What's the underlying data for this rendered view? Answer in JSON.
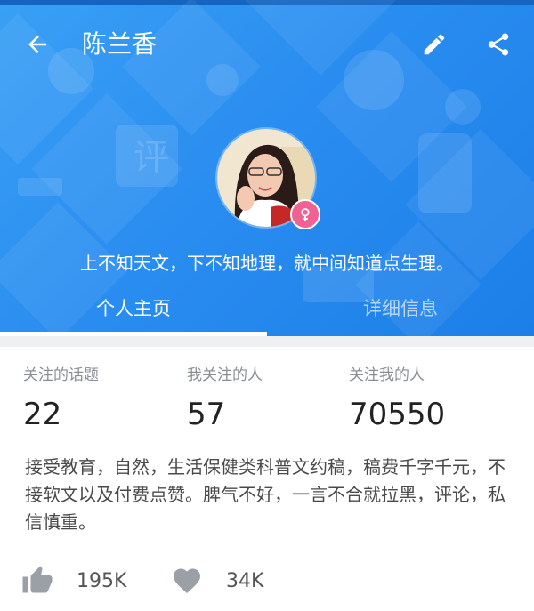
{
  "header": {
    "title": "陈兰香",
    "motto": "上不知天文，下不知地理，就中间知道点生理。",
    "tabs": [
      {
        "label": "个人主页",
        "active": true
      },
      {
        "label": "详细信息",
        "active": false
      }
    ],
    "icons": {
      "back": "arrow-left-icon",
      "edit": "pencil-icon",
      "share": "share-icon",
      "gender": "female-icon"
    },
    "colors": {
      "primary": "#2a8df0",
      "gender_badge": "#f06292"
    }
  },
  "stats": [
    {
      "label": "关注的话题",
      "value": "22"
    },
    {
      "label": "我关注的人",
      "value": "57"
    },
    {
      "label": "关注我的人",
      "value": "70550"
    }
  ],
  "bio": "接受教育，自然，生活保健类科普文约稿，稿费千字千元，不接软文以及付费点赞。脾气不好，一言不合就拉黑，评论，私信慎重。",
  "actions": {
    "likes": "195K",
    "favorites": "34K"
  }
}
